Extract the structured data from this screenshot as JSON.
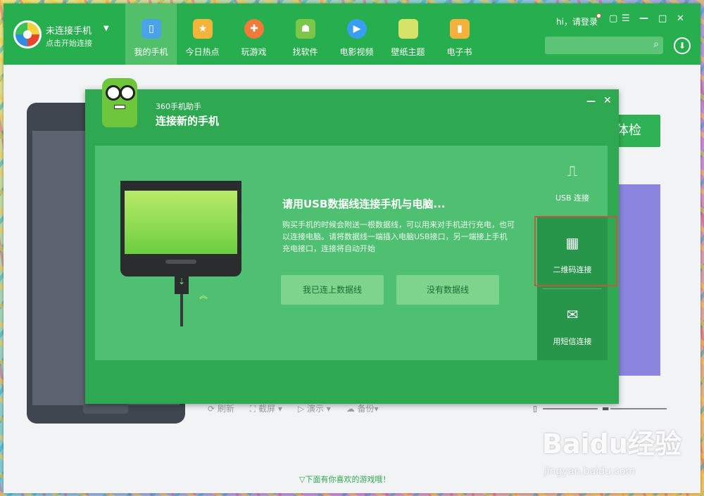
{
  "header": {
    "conn_title": "未连接手机",
    "conn_sub": "点击开始连接",
    "conn_dropdown": "▼",
    "greeting": "hi，请登录",
    "nav": [
      {
        "label": "我的手机",
        "icon": "phone-icon",
        "color": "#4aa3e8"
      },
      {
        "label": "今日热点",
        "icon": "star-icon",
        "color": "#f2b43a"
      },
      {
        "label": "玩游戏",
        "icon": "gamepad-icon",
        "color": "#f07a3a"
      },
      {
        "label": "找软件",
        "icon": "android-icon",
        "color": "#7cc74a"
      },
      {
        "label": "电影视频",
        "icon": "play-icon",
        "color": "#3a9ef0"
      },
      {
        "label": "壁纸主题",
        "icon": "picture-icon",
        "color": "#d5e36a"
      },
      {
        "label": "电子书",
        "icon": "book-icon",
        "color": "#f4b23c"
      }
    ],
    "win_controls": [
      "▢",
      "☰",
      "—",
      "□",
      "✕"
    ]
  },
  "background": {
    "check_label": "体检",
    "toolbar": [
      "⟳ 刷新",
      "⛶ 截屏 ▾",
      "▷ 演示 ▾",
      "☁ 备份▾"
    ],
    "bottom_hint": "▽下面有你喜欢的游戏哦！",
    "watermark": "Baidu经验",
    "watermark_sub": "jingyan.baidu.com"
  },
  "dialog": {
    "app_name": "360手机助手",
    "title": "连接新的手机",
    "message_title": "请用USB数据线连接手机与电脑...",
    "message_text": "购买手机的时候会附送一根数据线，可以用来对手机进行充电，也可以连接电脑。请将数据线一端插入电脑USB接口，另一端接上手机充电接口，连接将自动开始",
    "buttons": [
      "我已连上数据线",
      "没有数据线"
    ],
    "side_tabs": [
      {
        "label": "USB 连接",
        "icon": "usb-icon"
      },
      {
        "label": "二维码连接",
        "icon": "qrcode-icon"
      },
      {
        "label": "用短信连接",
        "icon": "envelope-icon"
      }
    ],
    "colors": {
      "dialog_bg": "#2fa852",
      "body_bg": "#4fbf71",
      "highlight": "#c55a3a"
    }
  }
}
